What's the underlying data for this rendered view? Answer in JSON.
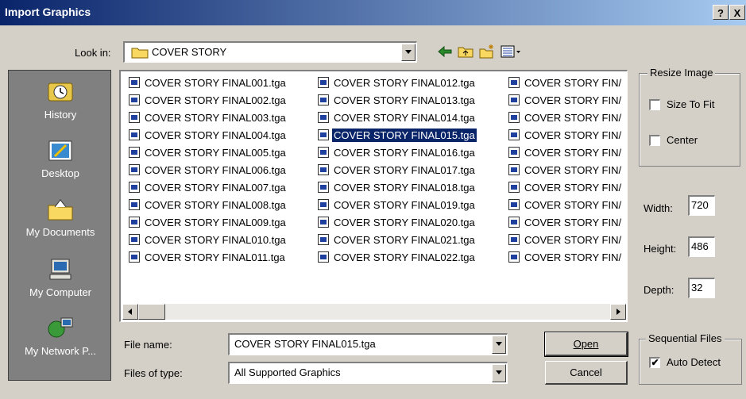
{
  "window": {
    "title": "Import Graphics",
    "help_btn": "?",
    "close_btn": "X"
  },
  "lookin": {
    "label": "Look in:",
    "value": "COVER STORY"
  },
  "places": [
    {
      "label": "History",
      "icon": "history-icon"
    },
    {
      "label": "Desktop",
      "icon": "desktop-icon"
    },
    {
      "label": "My Documents",
      "icon": "my-documents-icon"
    },
    {
      "label": "My Computer",
      "icon": "my-computer-icon"
    },
    {
      "label": "My Network P...",
      "icon": "my-network-places-icon"
    }
  ],
  "files": {
    "col1": [
      "COVER STORY FINAL001.tga",
      "COVER STORY FINAL002.tga",
      "COVER STORY FINAL003.tga",
      "COVER STORY FINAL004.tga",
      "COVER STORY FINAL005.tga",
      "COVER STORY FINAL006.tga",
      "COVER STORY FINAL007.tga",
      "COVER STORY FINAL008.tga",
      "COVER STORY FINAL009.tga",
      "COVER STORY FINAL010.tga",
      "COVER STORY FINAL011.tga"
    ],
    "col2": [
      "COVER STORY FINAL012.tga",
      "COVER STORY FINAL013.tga",
      "COVER STORY FINAL014.tga",
      "COVER STORY FINAL015.tga",
      "COVER STORY FINAL016.tga",
      "COVER STORY FINAL017.tga",
      "COVER STORY FINAL018.tga",
      "COVER STORY FINAL019.tga",
      "COVER STORY FINAL020.tga",
      "COVER STORY FINAL021.tga",
      "COVER STORY FINAL022.tga"
    ],
    "col3": [
      "COVER STORY FIN/",
      "COVER STORY FIN/",
      "COVER STORY FIN/",
      "COVER STORY FIN/",
      "COVER STORY FIN/",
      "COVER STORY FIN/",
      "COVER STORY FIN/",
      "COVER STORY FIN/",
      "COVER STORY FIN/",
      "COVER STORY FIN/",
      "COVER STORY FIN/"
    ],
    "selected": "COVER STORY FINAL015.tga"
  },
  "filename": {
    "label": "File name:",
    "value": "COVER STORY FINAL015.tga"
  },
  "filetype": {
    "label": "Files of type:",
    "value": "All Supported Graphics"
  },
  "buttons": {
    "open": "Open",
    "cancel": "Cancel"
  },
  "resize": {
    "title": "Resize Image",
    "size_to_fit": "Size To Fit",
    "center": "Center",
    "size_to_fit_checked": false,
    "center_checked": false
  },
  "dims": {
    "width_label": "Width:",
    "width": "720",
    "height_label": "Height:",
    "height": "486",
    "depth_label": "Depth:",
    "depth": "32"
  },
  "sequential": {
    "title": "Sequential Files",
    "auto_detect": "Auto Detect",
    "auto_detect_checked": true
  },
  "colors": {
    "title_start": "#0a246a",
    "title_end": "#a6caf0",
    "selection": "#0a246a",
    "face": "#d4d0c8"
  }
}
